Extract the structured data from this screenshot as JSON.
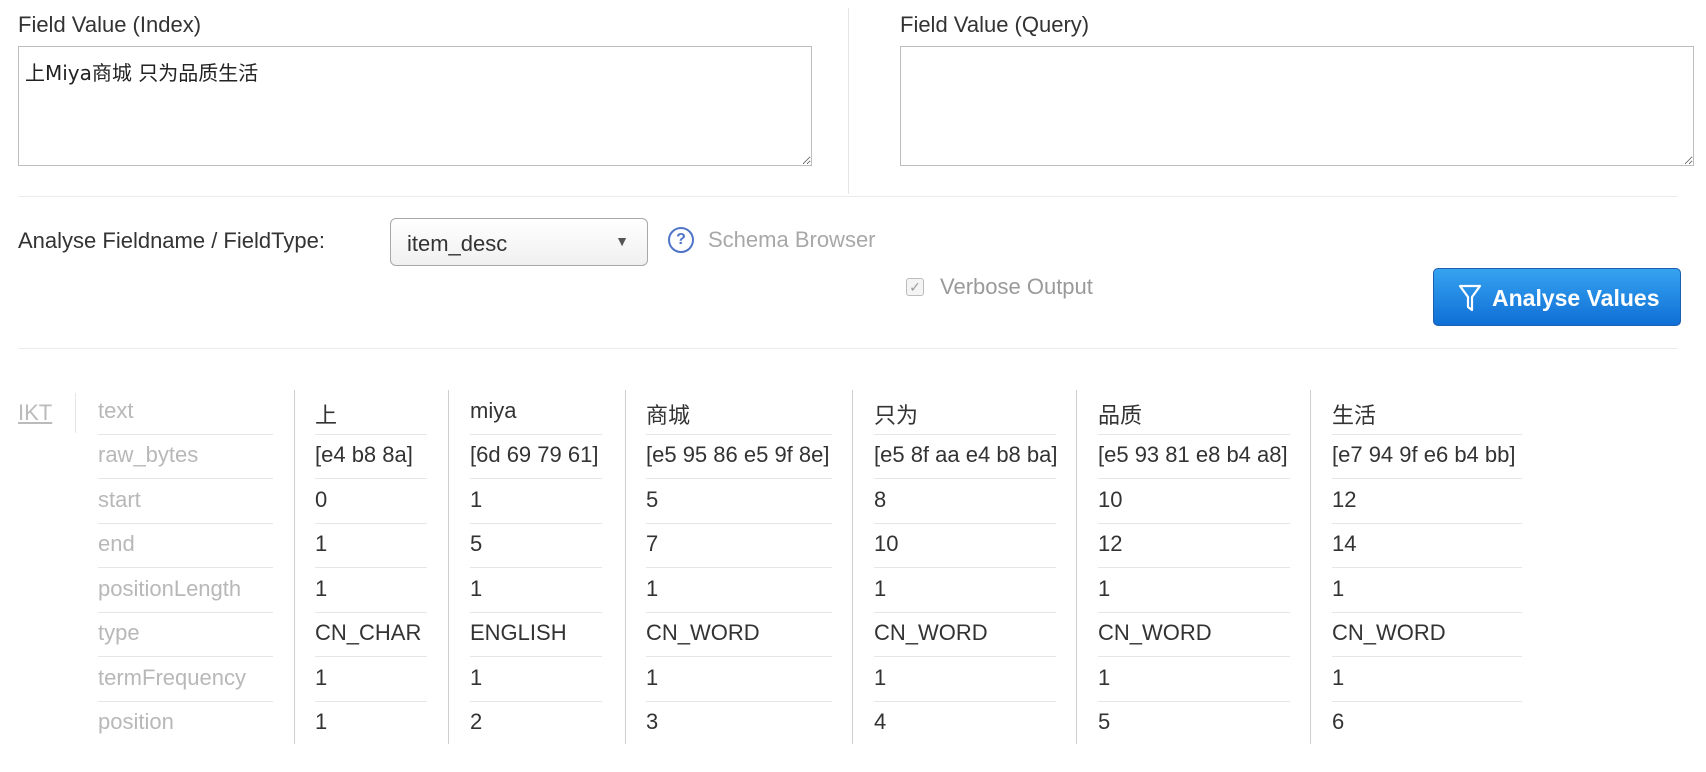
{
  "fields": {
    "index_label": "Field Value (Index)",
    "index_value": "上Miya商城 只为品质生活",
    "query_label": "Field Value (Query)",
    "query_value": ""
  },
  "analyse": {
    "label": "Analyse Fieldname / FieldType:",
    "selected": "item_desc",
    "help_glyph": "?",
    "schema_browser": "Schema Browser",
    "verbose_label": "Verbose Output",
    "verbose_checked": true,
    "button_label": "Analyse Values"
  },
  "results": {
    "analyzer": "IKT",
    "row_names": [
      "text",
      "raw_bytes",
      "start",
      "end",
      "positionLength",
      "type",
      "termFrequency",
      "position"
    ],
    "tokens": [
      {
        "text": "上",
        "raw_bytes": "[e4 b8 8a]",
        "start": "0",
        "end": "1",
        "positionLength": "1",
        "type": "CN_CHAR",
        "termFrequency": "1",
        "position": "1"
      },
      {
        "text": "miya",
        "raw_bytes": "[6d 69 79 61]",
        "start": "1",
        "end": "5",
        "positionLength": "1",
        "type": "ENGLISH",
        "termFrequency": "1",
        "position": "2"
      },
      {
        "text": "商城",
        "raw_bytes": "[e5 95 86 e5 9f 8e]",
        "start": "5",
        "end": "7",
        "positionLength": "1",
        "type": "CN_WORD",
        "termFrequency": "1",
        "position": "3"
      },
      {
        "text": "只为",
        "raw_bytes": "[e5 8f aa e4 b8 ba]",
        "start": "8",
        "end": "10",
        "positionLength": "1",
        "type": "CN_WORD",
        "termFrequency": "1",
        "position": "4"
      },
      {
        "text": "品质",
        "raw_bytes": "[e5 93 81 e8 b4 a8]",
        "start": "10",
        "end": "12",
        "positionLength": "1",
        "type": "CN_WORD",
        "termFrequency": "1",
        "position": "5"
      },
      {
        "text": "生活",
        "raw_bytes": "[e7 94 9f e6 b4 bb]",
        "start": "12",
        "end": "14",
        "positionLength": "1",
        "type": "CN_WORD",
        "termFrequency": "1",
        "position": "6"
      }
    ]
  },
  "colors": {
    "button_top": "#36a3f0",
    "button_bottom": "#0f6fd6",
    "help_icon": "#4f74c8"
  }
}
